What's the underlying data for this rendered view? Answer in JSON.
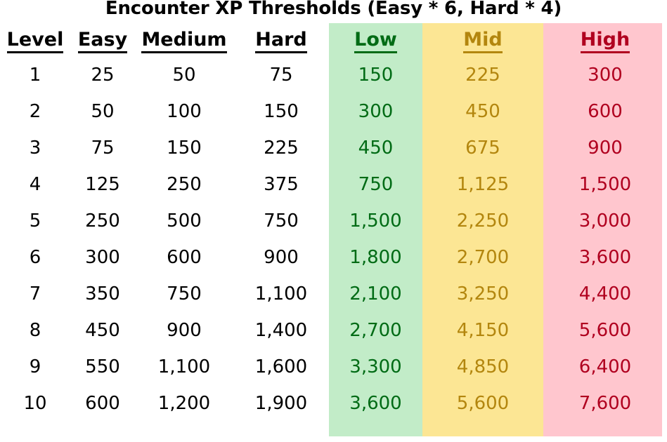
{
  "title": "Encounter XP Thresholds (Easy * 6, Hard * 4)",
  "colors": {
    "band_low_bg": "#c2ecc8",
    "band_mid_bg": "#fce694",
    "band_high_bg": "#ffc6ce",
    "text_plain": "#000000",
    "text_low": "#006b15",
    "text_mid": "#b3860e",
    "text_high": "#b0001f",
    "page_bg": "#ffffff"
  },
  "table": {
    "headers": [
      {
        "label": "Level",
        "key": "level",
        "color_class": "c-plain"
      },
      {
        "label": "Easy",
        "key": "easy",
        "color_class": "c-plain"
      },
      {
        "label": "Medium",
        "key": "medium",
        "color_class": "c-plain"
      },
      {
        "label": "Hard",
        "key": "hard",
        "color_class": "c-plain"
      },
      {
        "label": "Low",
        "key": "low",
        "color_class": "c-low"
      },
      {
        "label": "Mid",
        "key": "mid",
        "color_class": "c-mid"
      },
      {
        "label": "High",
        "key": "high",
        "color_class": "c-high"
      }
    ],
    "rows": [
      {
        "level": "1",
        "easy": "25",
        "medium": "50",
        "hard": "75",
        "low": "150",
        "mid": "225",
        "high": "300"
      },
      {
        "level": "2",
        "easy": "50",
        "medium": "100",
        "hard": "150",
        "low": "300",
        "mid": "450",
        "high": "600"
      },
      {
        "level": "3",
        "easy": "75",
        "medium": "150",
        "hard": "225",
        "low": "450",
        "mid": "675",
        "high": "900"
      },
      {
        "level": "4",
        "easy": "125",
        "medium": "250",
        "hard": "375",
        "low": "750",
        "mid": "1,125",
        "high": "1,500"
      },
      {
        "level": "5",
        "easy": "250",
        "medium": "500",
        "hard": "750",
        "low": "1,500",
        "mid": "2,250",
        "high": "3,000"
      },
      {
        "level": "6",
        "easy": "300",
        "medium": "600",
        "hard": "900",
        "low": "1,800",
        "mid": "2,700",
        "high": "3,600"
      },
      {
        "level": "7",
        "easy": "350",
        "medium": "750",
        "hard": "1,100",
        "low": "2,100",
        "mid": "3,250",
        "high": "4,400"
      },
      {
        "level": "8",
        "easy": "450",
        "medium": "900",
        "hard": "1,400",
        "low": "2,700",
        "mid": "4,150",
        "high": "5,600"
      },
      {
        "level": "9",
        "easy": "550",
        "medium": "1,100",
        "hard": "1,600",
        "low": "3,300",
        "mid": "4,850",
        "high": "6,400"
      },
      {
        "level": "10",
        "easy": "600",
        "medium": "1,200",
        "hard": "1,900",
        "low": "3,600",
        "mid": "5,600",
        "high": "7,600"
      }
    ]
  }
}
